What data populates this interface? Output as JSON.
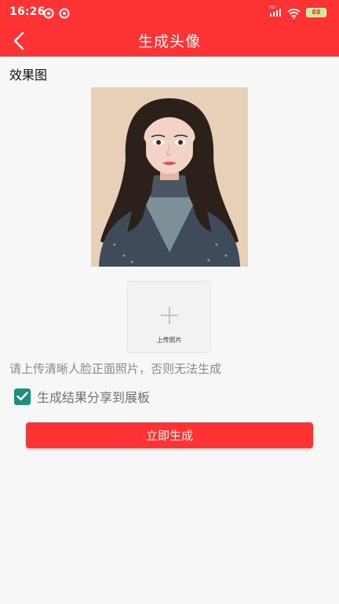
{
  "status_bar": {
    "time": "16:26",
    "battery": "88",
    "network_badge": "HD"
  },
  "header": {
    "title": "生成头像",
    "back_icon": "chevron-left-icon"
  },
  "main": {
    "section_label": "效果图",
    "upload": {
      "label": "上传照片",
      "icon": "plus-icon"
    },
    "hint": "请上传清晰人脸正面照片，否则无法生成",
    "share_option": {
      "label": "生成结果分享到展板",
      "checked": true
    },
    "primary_button": "立即生成"
  },
  "colors": {
    "brand_red": "#ff3333",
    "checkbox_teal": "#1e8f7c",
    "hint_gray": "#8a8a8a"
  }
}
